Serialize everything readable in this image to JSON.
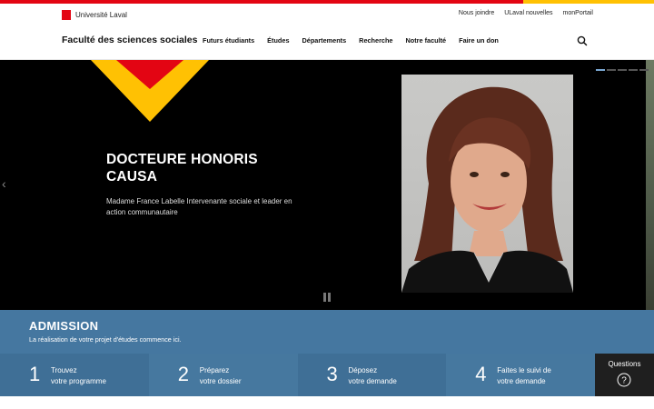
{
  "utility": {
    "logo_text": "Université Laval",
    "links": [
      "Nous joindre",
      "ULaval nouvelles",
      "monPortail"
    ]
  },
  "nav": {
    "site_title": "Faculté des sciences sociales",
    "items": [
      "Futurs étudiants",
      "Études",
      "Départements",
      "Recherche",
      "Notre faculté",
      "Faire un don"
    ]
  },
  "hero": {
    "title": "DOCTEURE HONORIS CAUSA",
    "text": "Madame France Labelle Intervenante sociale et leader en action communautaire",
    "slide_count": 5,
    "active_slide": 1
  },
  "admission": {
    "title": "ADMISSION",
    "subtitle": "La réalisation de votre projet d'études commence ici.",
    "steps": [
      {
        "num": "1",
        "line1": "Trouvez",
        "line2": "votre programme"
      },
      {
        "num": "2",
        "line1": "Préparez",
        "line2": "votre dossier"
      },
      {
        "num": "3",
        "line1": "Déposez",
        "line2": "votre demande"
      },
      {
        "num": "4",
        "line1": "Faites le suivi de",
        "line2": "votre demande"
      }
    ],
    "questions_label": "Questions"
  },
  "colors": {
    "brand_red": "#e30513",
    "brand_gold": "#ffc103",
    "admission_blue": "#4577a0"
  }
}
